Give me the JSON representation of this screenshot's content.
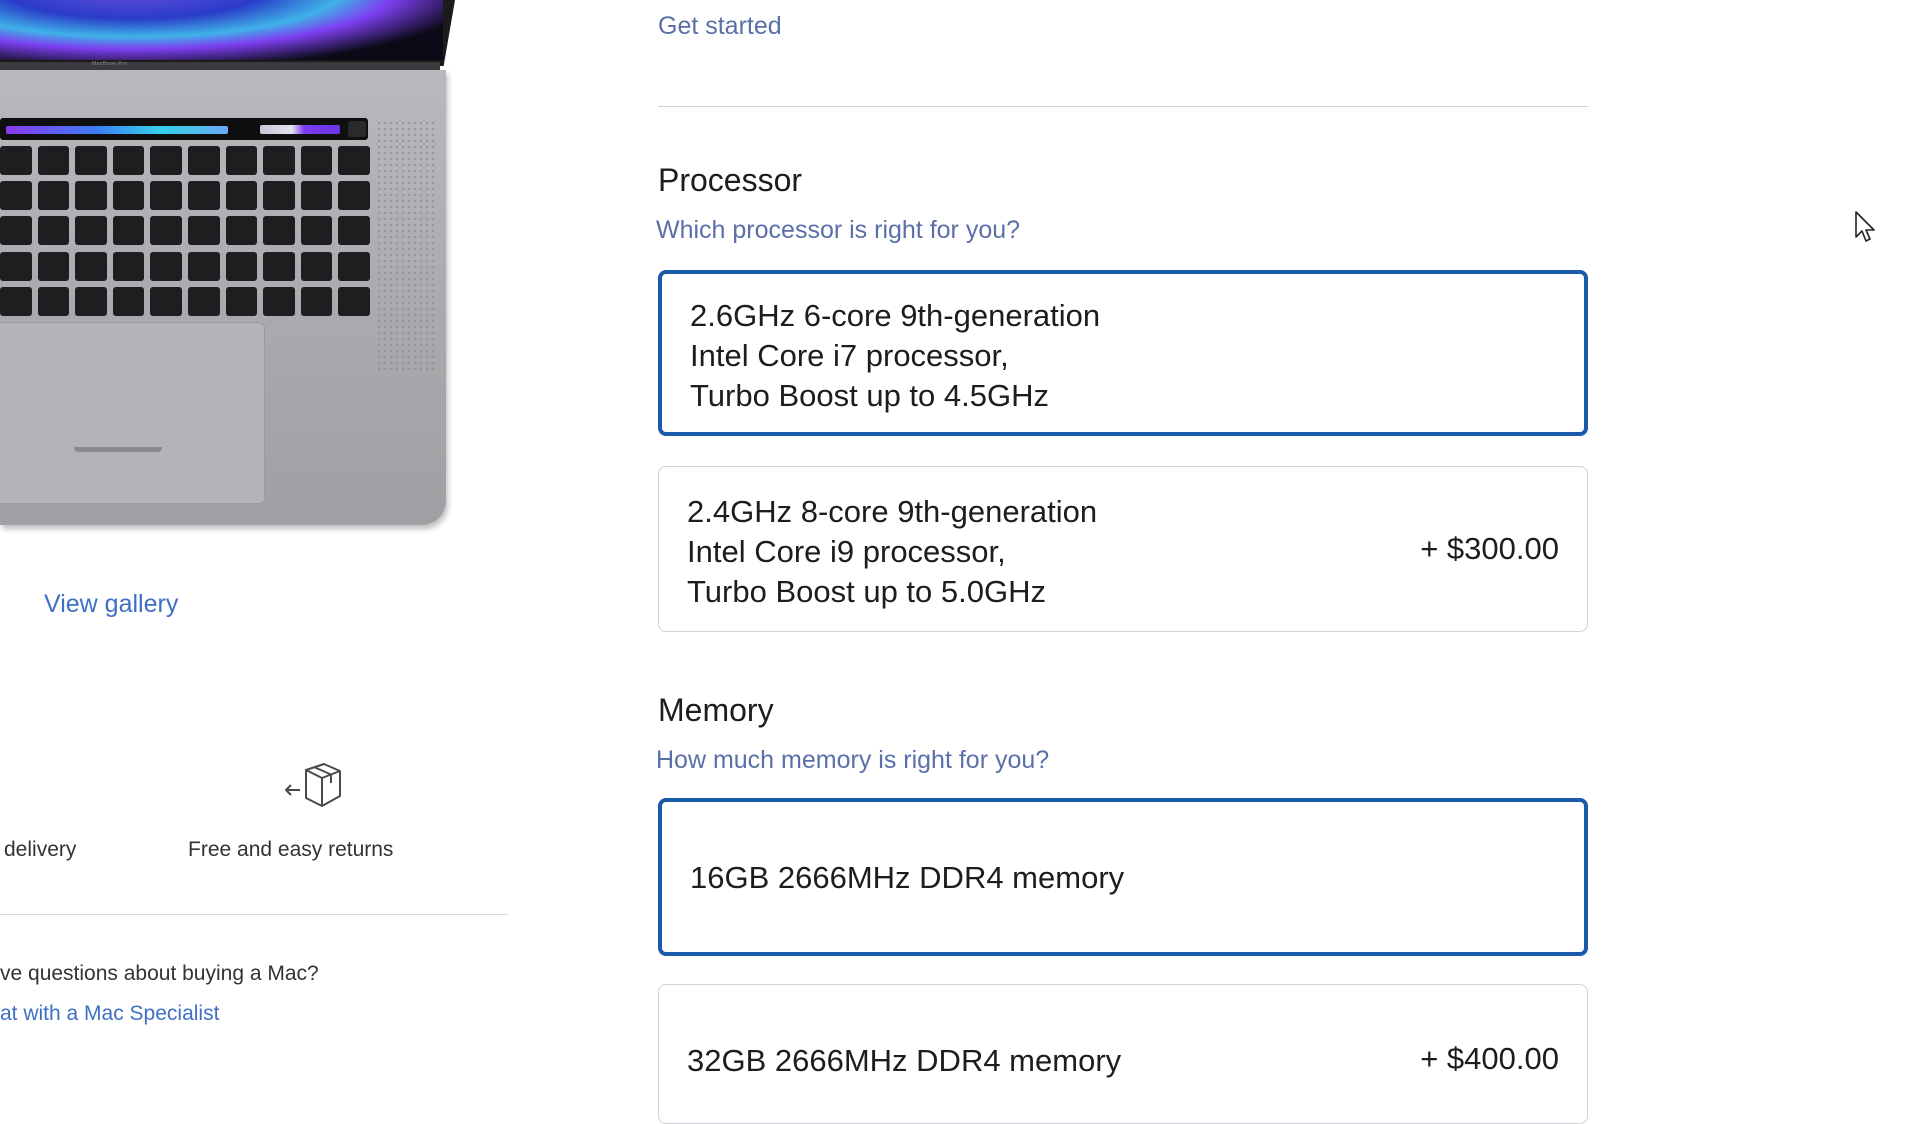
{
  "left": {
    "laptop_label": "MacBook Pro",
    "view_gallery": "View gallery",
    "benefits": {
      "delivery": "delivery",
      "returns": "Free and easy returns"
    },
    "questions": "ve questions about buying a Mac?",
    "chat_link": "at with a Mac Specialist"
  },
  "right": {
    "get_started": "Get started",
    "processor": {
      "title": "Processor",
      "help_link": "Which processor is right for you?",
      "options": [
        {
          "line1": "2.6GHz 6-core 9th-generation",
          "line2": "Intel Core i7 processor,",
          "line3": "Turbo Boost up to 4.5GHz",
          "price": "",
          "selected": true
        },
        {
          "line1": "2.4GHz 8-core 9th-generation",
          "line2": "Intel Core i9 processor,",
          "line3": "Turbo Boost up to 5.0GHz",
          "price": "+ $300.00",
          "selected": false
        }
      ]
    },
    "memory": {
      "title": "Memory",
      "help_link": "How much memory is right for you?",
      "options": [
        {
          "label": "16GB 2666MHz DDR4 memory",
          "price": "",
          "selected": true
        },
        {
          "label": "32GB 2666MHz DDR4 memory",
          "price": "+ $400.00",
          "selected": false
        }
      ]
    }
  },
  "colors": {
    "selected_border": "#1a5aa8",
    "link": "#5b6fa8",
    "link_strong": "#3f6fc4",
    "text": "#1d1d1f"
  },
  "icons": {
    "returns": "box-return-icon",
    "cursor": "mouse-pointer-icon"
  }
}
